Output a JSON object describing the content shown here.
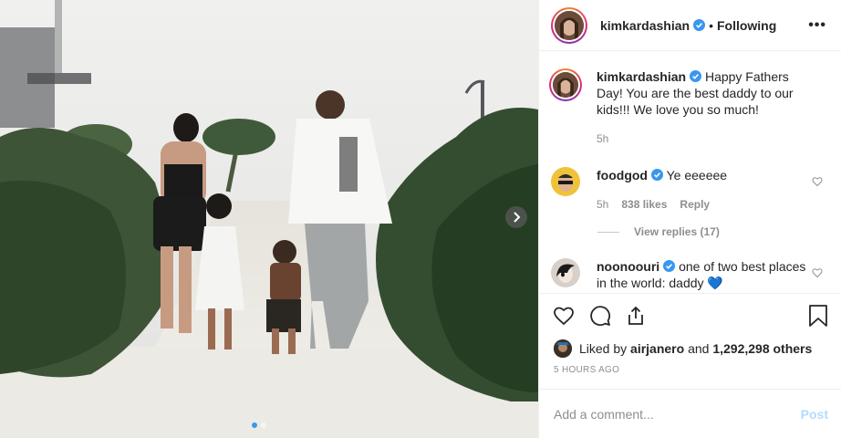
{
  "header": {
    "username": "kimkardashian",
    "separator": "•",
    "follow_status": "Following",
    "more": "•••"
  },
  "comments": [
    {
      "username": "kimkardashian",
      "text": "Happy Fathers Day! You are the best daddy to our kids!!! We love you so much!",
      "time": "5h"
    },
    {
      "username": "foodgod",
      "text": "Ye eeeeee",
      "time": "5h",
      "likes": "838 likes",
      "reply": "Reply",
      "view_replies": "View replies (17)"
    },
    {
      "username": "noonoouri",
      "text": "one of two best places in the world: daddy",
      "emoji": "💙"
    }
  ],
  "likes": {
    "prefix": "Liked by",
    "user": "airjanero",
    "joiner": "and",
    "count": "1,292,298 others"
  },
  "timestamp": "5 HOURS AGO",
  "add_comment": {
    "placeholder": "Add a comment...",
    "post": "Post"
  },
  "carousel": {
    "current": 1,
    "total": 2
  },
  "colors": {
    "verified": "#3897f0",
    "post_button": "#b3dbff",
    "meta": "#8e8e8e"
  }
}
